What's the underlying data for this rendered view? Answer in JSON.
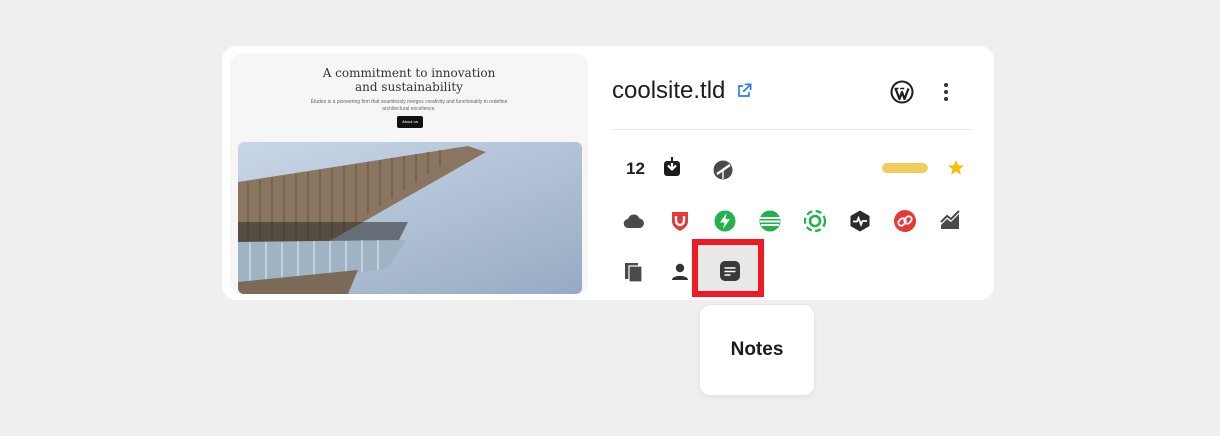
{
  "preview": {
    "heading_line1": "A commitment to innovation",
    "heading_line2": "and sustainability",
    "subtext": "Études is a pioneering firm that seamlessly merges creativity and functionality to redefine architectural excellence.",
    "button_label": "About us"
  },
  "site": {
    "title": "coolsite.tld"
  },
  "stats": {
    "backup_count": "12"
  },
  "icons": {
    "row1": [
      "download-backup-icon",
      "performance-gauge-icon",
      "tag-pill",
      "star-icon"
    ],
    "row2": [
      "cloud-icon",
      "shield-icon",
      "lightning-icon",
      "layers-icon",
      "cdn-icon",
      "activity-icon",
      "link-icon",
      "analytics-icon"
    ],
    "row3": [
      "copy-icon",
      "user-icon",
      "notes-icon"
    ]
  },
  "tooltip": {
    "label": "Notes"
  },
  "colors": {
    "accent_blue": "#2b7de9",
    "red": "#e53935",
    "green": "#22b24c",
    "gray": "#4a4a4a",
    "tag_yellow": "#f1cc5b",
    "star_yellow": "#f5c000",
    "highlight_red": "#ee1b24"
  }
}
